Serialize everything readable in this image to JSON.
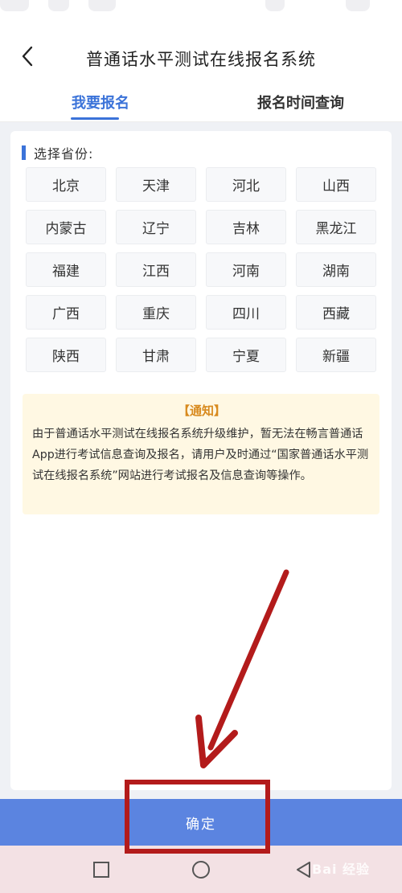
{
  "header": {
    "title": "普通话水平测试在线报名系统"
  },
  "tabs": [
    {
      "label": "我要报名",
      "active": true
    },
    {
      "label": "报名时间查询",
      "active": false
    }
  ],
  "section": {
    "label": "选择省份:"
  },
  "provinces": [
    "北京",
    "天津",
    "河北",
    "山西",
    "内蒙古",
    "辽宁",
    "吉林",
    "黑龙江",
    "福建",
    "江西",
    "河南",
    "湖南",
    "广西",
    "重庆",
    "四川",
    "西藏",
    "陕西",
    "甘肃",
    "宁夏",
    "新疆"
  ],
  "notice": {
    "title": "【通知】",
    "body": "由于普通话水平测试在线报名系统升级维护，暂无法在畅言普通话App进行考试信息查询及报名，请用户及时通过“国家普通话水平测试在线报名系统”网站进行考试报名及信息查询等操作。"
  },
  "confirm_label": "确定",
  "watermark": "Bai 经验",
  "colors": {
    "accent": "#3b73d9",
    "confirm_bg": "#5b84e0",
    "notice_bg": "#fff8e3",
    "notice_title": "#d88a1e",
    "annotation": "#b31b1b"
  },
  "icons": {
    "back": "chevron-left-icon",
    "nav_recent": "square-icon",
    "nav_home": "circle-icon",
    "nav_back": "triangle-left-icon"
  }
}
